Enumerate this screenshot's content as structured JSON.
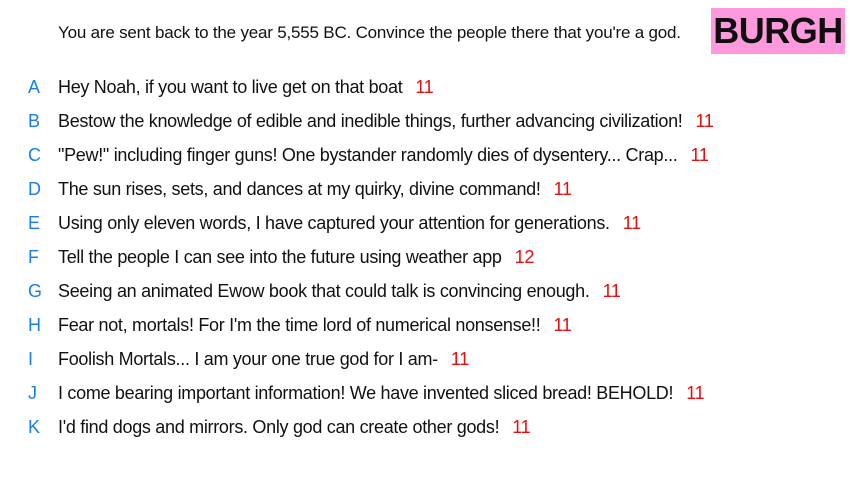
{
  "prompt": "You are sent back to the year 5,555 BC. Convince the people there that you're a god.",
  "badge": "BURGH",
  "colors": {
    "letter": "#1a7fe0",
    "score": "#e01010",
    "badge_bg": "#ff99dd"
  },
  "answers": [
    {
      "letter": "A",
      "text": "Hey Noah, if you want to live get on that boat",
      "score": "11"
    },
    {
      "letter": "B",
      "text": "Bestow the knowledge of edible and inedible things, further advancing civilization!",
      "score": "11"
    },
    {
      "letter": "C",
      "text": "\"Pew!\" including finger guns! One bystander randomly dies of dysentery... Crap...",
      "score": "11"
    },
    {
      "letter": "D",
      "text": "The sun rises, sets, and dances at my quirky, divine command!",
      "score": "11"
    },
    {
      "letter": "E",
      "text": "Using only eleven words, I have captured your attention for generations.",
      "score": "11"
    },
    {
      "letter": "F",
      "text": "Tell the people I can see into the future using weather app",
      "score": "12"
    },
    {
      "letter": "G",
      "text": "Seeing an animated Ewow book that could talk is convincing enough.",
      "score": "11"
    },
    {
      "letter": "H",
      "text": "Fear not, mortals! For I'm the time lord of numerical nonsense!!",
      "score": "11"
    },
    {
      "letter": "I",
      "text": "Foolish Mortals... I am your one true god for I am-",
      "score": "11"
    },
    {
      "letter": "J",
      "text": "I come bearing important information! We have invented sliced bread! BEHOLD!",
      "score": "11"
    },
    {
      "letter": "K",
      "text": "I'd find dogs and mirrors. Only god can create other gods!",
      "score": "11"
    }
  ]
}
